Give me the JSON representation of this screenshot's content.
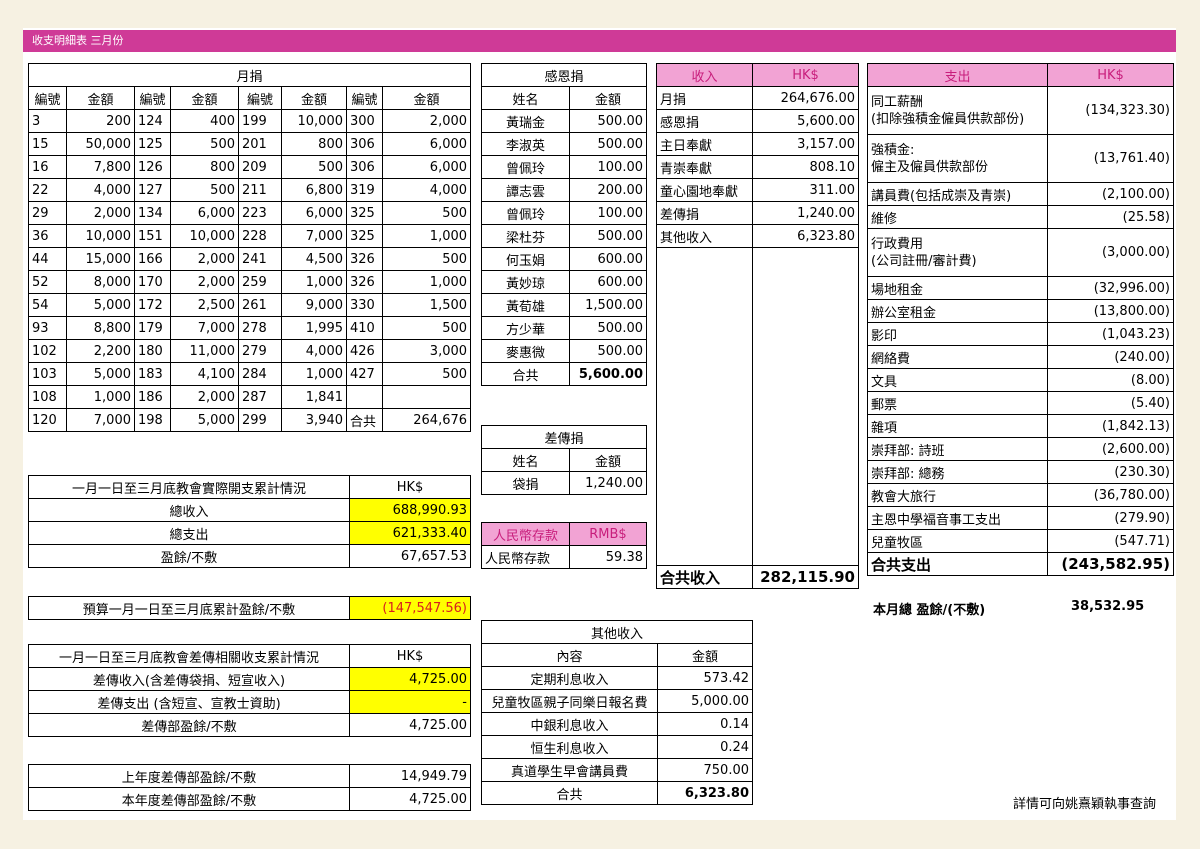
{
  "banner": "收支明細表 三月份",
  "monthly": {
    "title": "月捐",
    "headers": [
      "編號",
      "金額",
      "編號",
      "金額",
      "編號",
      "金額",
      "編號",
      "金額"
    ],
    "rows": [
      [
        "3",
        "200",
        "124",
        "400",
        "199",
        "10,000",
        "300",
        "2,000"
      ],
      [
        "15",
        "50,000",
        "125",
        "500",
        "201",
        "800",
        "306",
        "6,000"
      ],
      [
        "16",
        "7,800",
        "126",
        "800",
        "209",
        "500",
        "306",
        "6,000"
      ],
      [
        "22",
        "4,000",
        "127",
        "500",
        "211",
        "6,800",
        "319",
        "4,000"
      ],
      [
        "29",
        "2,000",
        "134",
        "6,000",
        "223",
        "6,000",
        "325",
        "500"
      ],
      [
        "36",
        "10,000",
        "151",
        "10,000",
        "228",
        "7,000",
        "325",
        "1,000"
      ],
      [
        "44",
        "15,000",
        "166",
        "2,000",
        "241",
        "4,500",
        "326",
        "500"
      ],
      [
        "52",
        "8,000",
        "170",
        "2,000",
        "259",
        "1,000",
        "326",
        "1,000"
      ],
      [
        "54",
        "5,000",
        "172",
        "2,500",
        "261",
        "9,000",
        "330",
        "1,500"
      ],
      [
        "93",
        "8,800",
        "179",
        "7,000",
        "278",
        "1,995",
        "410",
        "500"
      ],
      [
        "102",
        "2,200",
        "180",
        "11,000",
        "279",
        "4,000",
        "426",
        "3,000"
      ],
      [
        "103",
        "5,000",
        "183",
        "4,100",
        "284",
        "1,000",
        "427",
        "500"
      ],
      [
        "108",
        "1,000",
        "186",
        "2,000",
        "287",
        "1,841",
        "",
        ""
      ],
      [
        "120",
        "7,000",
        "198",
        "5,000",
        "299",
        "3,940",
        "合共",
        "264,676"
      ]
    ]
  },
  "thanks": {
    "title": "感恩捐",
    "headers": [
      "姓名",
      "金額"
    ],
    "rows": [
      [
        "黃瑞金",
        "500.00"
      ],
      [
        "李淑英",
        "500.00"
      ],
      [
        "曾佩玲",
        "100.00"
      ],
      [
        "譚志雲",
        "200.00"
      ],
      [
        "曾佩玲",
        "100.00"
      ],
      [
        "梁杜芬",
        "500.00"
      ],
      [
        "何玉娟",
        "600.00"
      ],
      [
        "黃妙琼",
        "600.00"
      ],
      [
        "黃荀雄",
        "1,500.00"
      ],
      [
        "方少華",
        "500.00"
      ],
      [
        "麥惠微",
        "500.00"
      ]
    ],
    "total_label": "合共",
    "total": "5,600.00"
  },
  "mission": {
    "title": "差傳捐",
    "headers": [
      "姓名",
      "金額"
    ],
    "rows": [
      [
        "袋捐",
        "1,240.00"
      ]
    ]
  },
  "rmb": {
    "headers": [
      "人民幣存款",
      "RMB$"
    ],
    "rows": [
      [
        "人民幣存款",
        "59.38"
      ]
    ]
  },
  "income": {
    "headers": [
      "收入",
      "HK$"
    ],
    "rows": [
      [
        "月捐",
        "264,676.00"
      ],
      [
        "感恩捐",
        "5,600.00"
      ],
      [
        "主日奉獻",
        "3,157.00"
      ],
      [
        "青崇奉獻",
        "808.10"
      ],
      [
        "童心園地奉獻",
        "311.00"
      ],
      [
        "差傳捐",
        "1,240.00"
      ],
      [
        "其他收入",
        "6,323.80"
      ]
    ],
    "total_label": "合共收入",
    "total": "282,115.90"
  },
  "expense": {
    "headers": [
      "支出",
      "HK$"
    ],
    "rows": [
      [
        "同工薪酬\n(扣除強積金僱員供款部份)",
        "(134,323.30)"
      ],
      [
        "強積金:\n僱主及僱員供款部份",
        "(13,761.40)"
      ],
      [
        "講員費(包括成崇及青崇)",
        "(2,100.00)"
      ],
      [
        "維修",
        "(25.58)"
      ],
      [
        "行政費用\n(公司註冊/審計費)",
        "(3,000.00)"
      ],
      [
        "場地租金",
        "(32,996.00)"
      ],
      [
        "辦公室租金",
        "(13,800.00)"
      ],
      [
        "影印",
        "(1,043.23)"
      ],
      [
        "網絡費",
        "(240.00)"
      ],
      [
        "文具",
        "(8.00)"
      ],
      [
        "郵票",
        "(5.40)"
      ],
      [
        "雜項",
        "(1,842.13)"
      ],
      [
        "崇拜部: 詩班",
        "(2,600.00)"
      ],
      [
        "崇拜部: 總務",
        "(230.30)"
      ],
      [
        "教會大旅行",
        "(36,780.00)"
      ],
      [
        "主恩中學福音事工支出",
        "(279.90)"
      ],
      [
        "兒童牧區",
        "(547.71)"
      ]
    ],
    "total_label": "合共支出",
    "total": "(243,582.95)"
  },
  "surplus": {
    "label": "本月總 盈餘/(不敷)",
    "value": "38,532.95"
  },
  "cumulative": {
    "title": "一月一日至三月底教會實際開支累計情況",
    "currency": "HK$",
    "rows": [
      [
        "總收入",
        "688,990.93"
      ],
      [
        "總支出",
        "621,333.40"
      ],
      [
        "盈餘/不敷",
        "67,657.53"
      ]
    ]
  },
  "budget": {
    "label": "預算一月一日至三月底累計盈餘/不敷",
    "value": "(147,547.56)"
  },
  "mission_cum": {
    "title": "一月一日至三月底教會差傳相關收支累計情況",
    "currency": "HK$",
    "rows": [
      [
        "差傳收入(含差傳袋捐、短宣收入)",
        "4,725.00"
      ],
      [
        "差傳支出 (含短宣、宣教士資助)",
        "-"
      ],
      [
        "差傳部盈餘/不敷",
        "4,725.00"
      ]
    ]
  },
  "yearly": {
    "rows": [
      [
        "上年度差傳部盈餘/不敷",
        "14,949.79"
      ],
      [
        "本年度差傳部盈餘/不敷",
        "4,725.00"
      ]
    ]
  },
  "other_income": {
    "title": "其他收入",
    "headers": [
      "內容",
      "金額"
    ],
    "rows": [
      [
        "定期利息收入",
        "573.42"
      ],
      [
        "兒童牧區親子同樂日報名費",
        "5,000.00"
      ],
      [
        "中銀利息收入",
        "0.14"
      ],
      [
        "恒生利息收入",
        "0.24"
      ],
      [
        "真道學生早會講員費",
        "750.00"
      ]
    ],
    "total_label": "合共",
    "total": "6,323.80"
  },
  "footnote": "詳情可向姚熹穎執事查詢",
  "colors": {
    "banner": "#cf3a97",
    "header_pink": "#f2a3d4",
    "highlight": "#ffff00",
    "deficit_red": "#d81e1e",
    "page_bg": "#f6f1e2"
  }
}
